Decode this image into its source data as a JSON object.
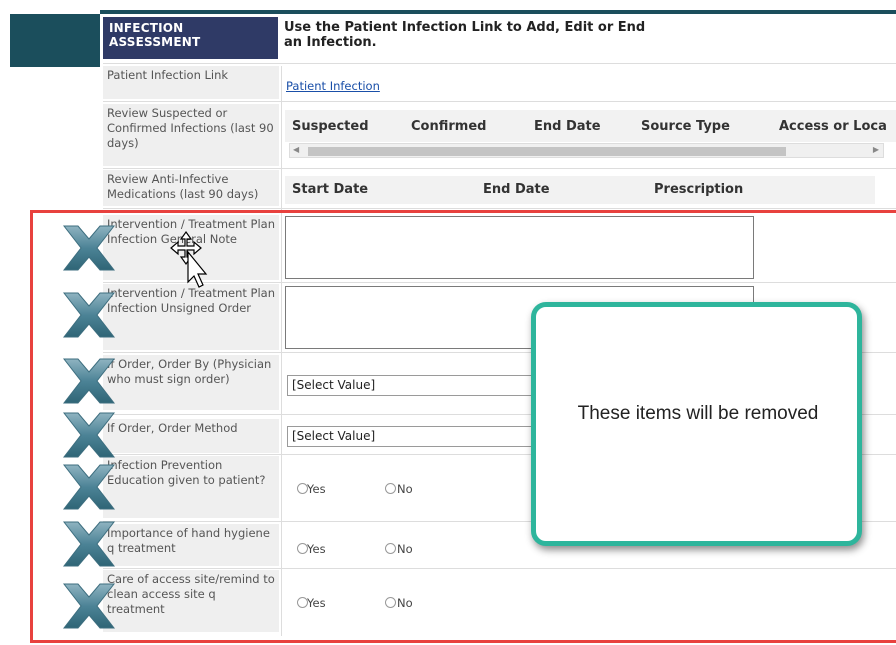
{
  "header": {
    "section_title": "INFECTION ASSESSMENT",
    "instruction": "Use the Patient Infection Link to Add, Edit or End an Infection."
  },
  "rows": {
    "patient_infection_link": {
      "label": "Patient Infection Link",
      "link_text": "Patient Infection"
    },
    "review_infections": {
      "label": "Review Suspected or Confirmed Infections (last 90 days)",
      "columns": [
        "Suspected",
        "Confirmed",
        "End Date",
        "Source Type",
        "Access or Loca"
      ]
    },
    "review_anti_infective": {
      "label": "Review Anti-Infective Medications (last 90 days)",
      "columns": [
        "Start Date",
        "End Date",
        "Prescription"
      ]
    },
    "general_note": {
      "label": "Intervention / Treatment Plan Infection General Note",
      "value": ""
    },
    "unsigned_order": {
      "label": "Intervention / Treatment Plan Infection Unsigned Order",
      "value": ""
    },
    "order_by": {
      "label": "If Order, Order By (Physician who must sign order)",
      "value": "[Select Value]"
    },
    "order_method": {
      "label": "If Order, Order Method",
      "value": "[Select Value]"
    },
    "education": {
      "label": "Infection Prevention Education given to patient?",
      "yes": "Yes",
      "no": "No"
    },
    "hand_hygiene": {
      "label": "Importance of hand hygiene q treatment",
      "yes": "Yes",
      "no": "No"
    },
    "access_site": {
      "label": "Care of access site/remind to clean access site q treatment",
      "yes": "Yes",
      "no": "No"
    }
  },
  "callout": {
    "text": "These items will be removed"
  },
  "colors": {
    "accent_teal": "#2eb59c",
    "highlight_red": "#e8413e",
    "header_navy": "#2f3a66",
    "dark_teal": "#1b4e5c"
  },
  "icons": {
    "delete_mark": "x-mark-icon",
    "cursor": "move-cursor-icon"
  }
}
